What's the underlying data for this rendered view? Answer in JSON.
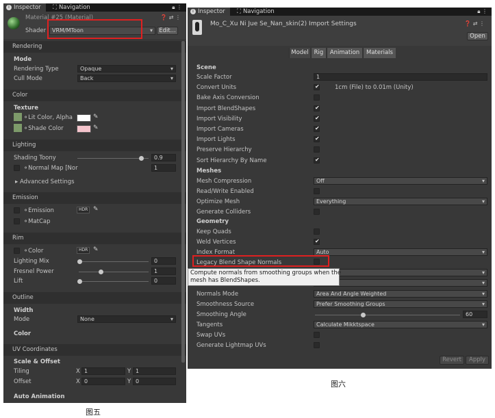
{
  "left": {
    "tabs": {
      "inspector": "Inspector",
      "navigation": "Navigation"
    },
    "material_title": "Material #25 (Material)",
    "shader_label": "Shader",
    "shader_value": "VRM/MToon",
    "edit_button": "Edit...",
    "rendering": {
      "header": "Rendering",
      "sub": "Mode",
      "type_label": "Rendering Type",
      "type_value": "Opaque",
      "cull_label": "Cull Mode",
      "cull_value": "Back"
    },
    "color": {
      "header": "Color",
      "sub": "Texture",
      "lit_label": "Lit Color, Alpha",
      "shade_label": "Shade Color",
      "lit_color": "#ffffff",
      "shade_color": "#f4c4cc"
    },
    "lighting": {
      "header": "Lighting",
      "shading_toony_label": "Shading Toony",
      "shading_toony_value": "0.9",
      "shading_toony_level": 0.9,
      "normal_map_label": "Normal Map [Nor",
      "normal_map_value": "1",
      "advanced": "Advanced Settings"
    },
    "emission": {
      "header": "Emission",
      "emission_label": "Emission",
      "hdr": "HDR",
      "matcap_label": "MatCap"
    },
    "rim": {
      "header": "Rim",
      "color_label": "Color",
      "hdr": "HDR",
      "lighting_mix_label": "Lighting Mix",
      "lighting_mix_value": "0",
      "fresnel_label": "Fresnel Power",
      "fresnel_value": "1",
      "lift_label": "Lift",
      "lift_value": "0"
    },
    "outline": {
      "header": "Outline",
      "width_sub": "Width",
      "mode_label": "Mode",
      "mode_value": "None",
      "color_sub": "Color"
    },
    "uv": {
      "header": "UV Coordinates",
      "sub": "Scale & Offset",
      "tiling_label": "Tiling",
      "offset_label": "Offset",
      "x": "X",
      "y": "Y",
      "tiling_x": "1",
      "tiling_y": "1",
      "offset_x": "0",
      "offset_y": "0",
      "auto_anim": "Auto Animation"
    }
  },
  "right": {
    "tabs": {
      "inspector": "Inspector",
      "navigation": "Navigation"
    },
    "title": "Mo_C_Xu Ni Jue Se_Nan_skin(2) Import Settings",
    "open_button": "Open",
    "model_tabs": [
      "Model",
      "Rig",
      "Animation",
      "Materials"
    ],
    "scene": {
      "header": "Scene",
      "scale_factor_label": "Scale Factor",
      "scale_factor_value": "1",
      "convert_units_label": "Convert Units",
      "convert_units_note": "1cm (File) to 0.01m (Unity)",
      "bake_axis_label": "Bake Axis Conversion",
      "import_blendshapes_label": "Import BlendShapes",
      "import_visibility_label": "Import Visibility",
      "import_cameras_label": "Import Cameras",
      "import_lights_label": "Import Lights",
      "preserve_hierarchy_label": "Preserve Hierarchy",
      "sort_hierarchy_label": "Sort Hierarchy By Name"
    },
    "meshes": {
      "header": "Meshes",
      "compression_label": "Mesh Compression",
      "compression_value": "Off",
      "read_write_label": "Read/Write Enabled",
      "optimize_label": "Optimize Mesh",
      "optimize_value": "Everything",
      "colliders_label": "Generate Colliders"
    },
    "geometry": {
      "header": "Geometry",
      "keep_quads_label": "Keep Quads",
      "weld_label": "Weld Vertices",
      "index_format_label": "Index Format",
      "index_format_value": "Auto",
      "legacy_label": "Legacy Blend Shape Normals",
      "normals_mode_label": "Normals Mode",
      "normals_mode_value": "Area And Angle Weighted",
      "smoothness_label": "Smoothness Source",
      "smoothness_value": "Prefer Smoothing Groups",
      "angle_label": "Smoothing Angle",
      "angle_value": "60",
      "tangents_label": "Tangents",
      "tangents_value": "Calculate Mikktspace",
      "swap_uvs_label": "Swap UVs",
      "lightmap_label": "Generate Lightmap UVs"
    },
    "tooltip_line1": "Compute normals from smoothing groups when the",
    "tooltip_line2": "mesh has BlendShapes.",
    "revert_button": "Revert",
    "apply_button": "Apply"
  },
  "captions": {
    "left": "图五",
    "right": "图六"
  },
  "colors": {
    "highlight_box": "#e02020",
    "panel_bg": "#383838"
  }
}
